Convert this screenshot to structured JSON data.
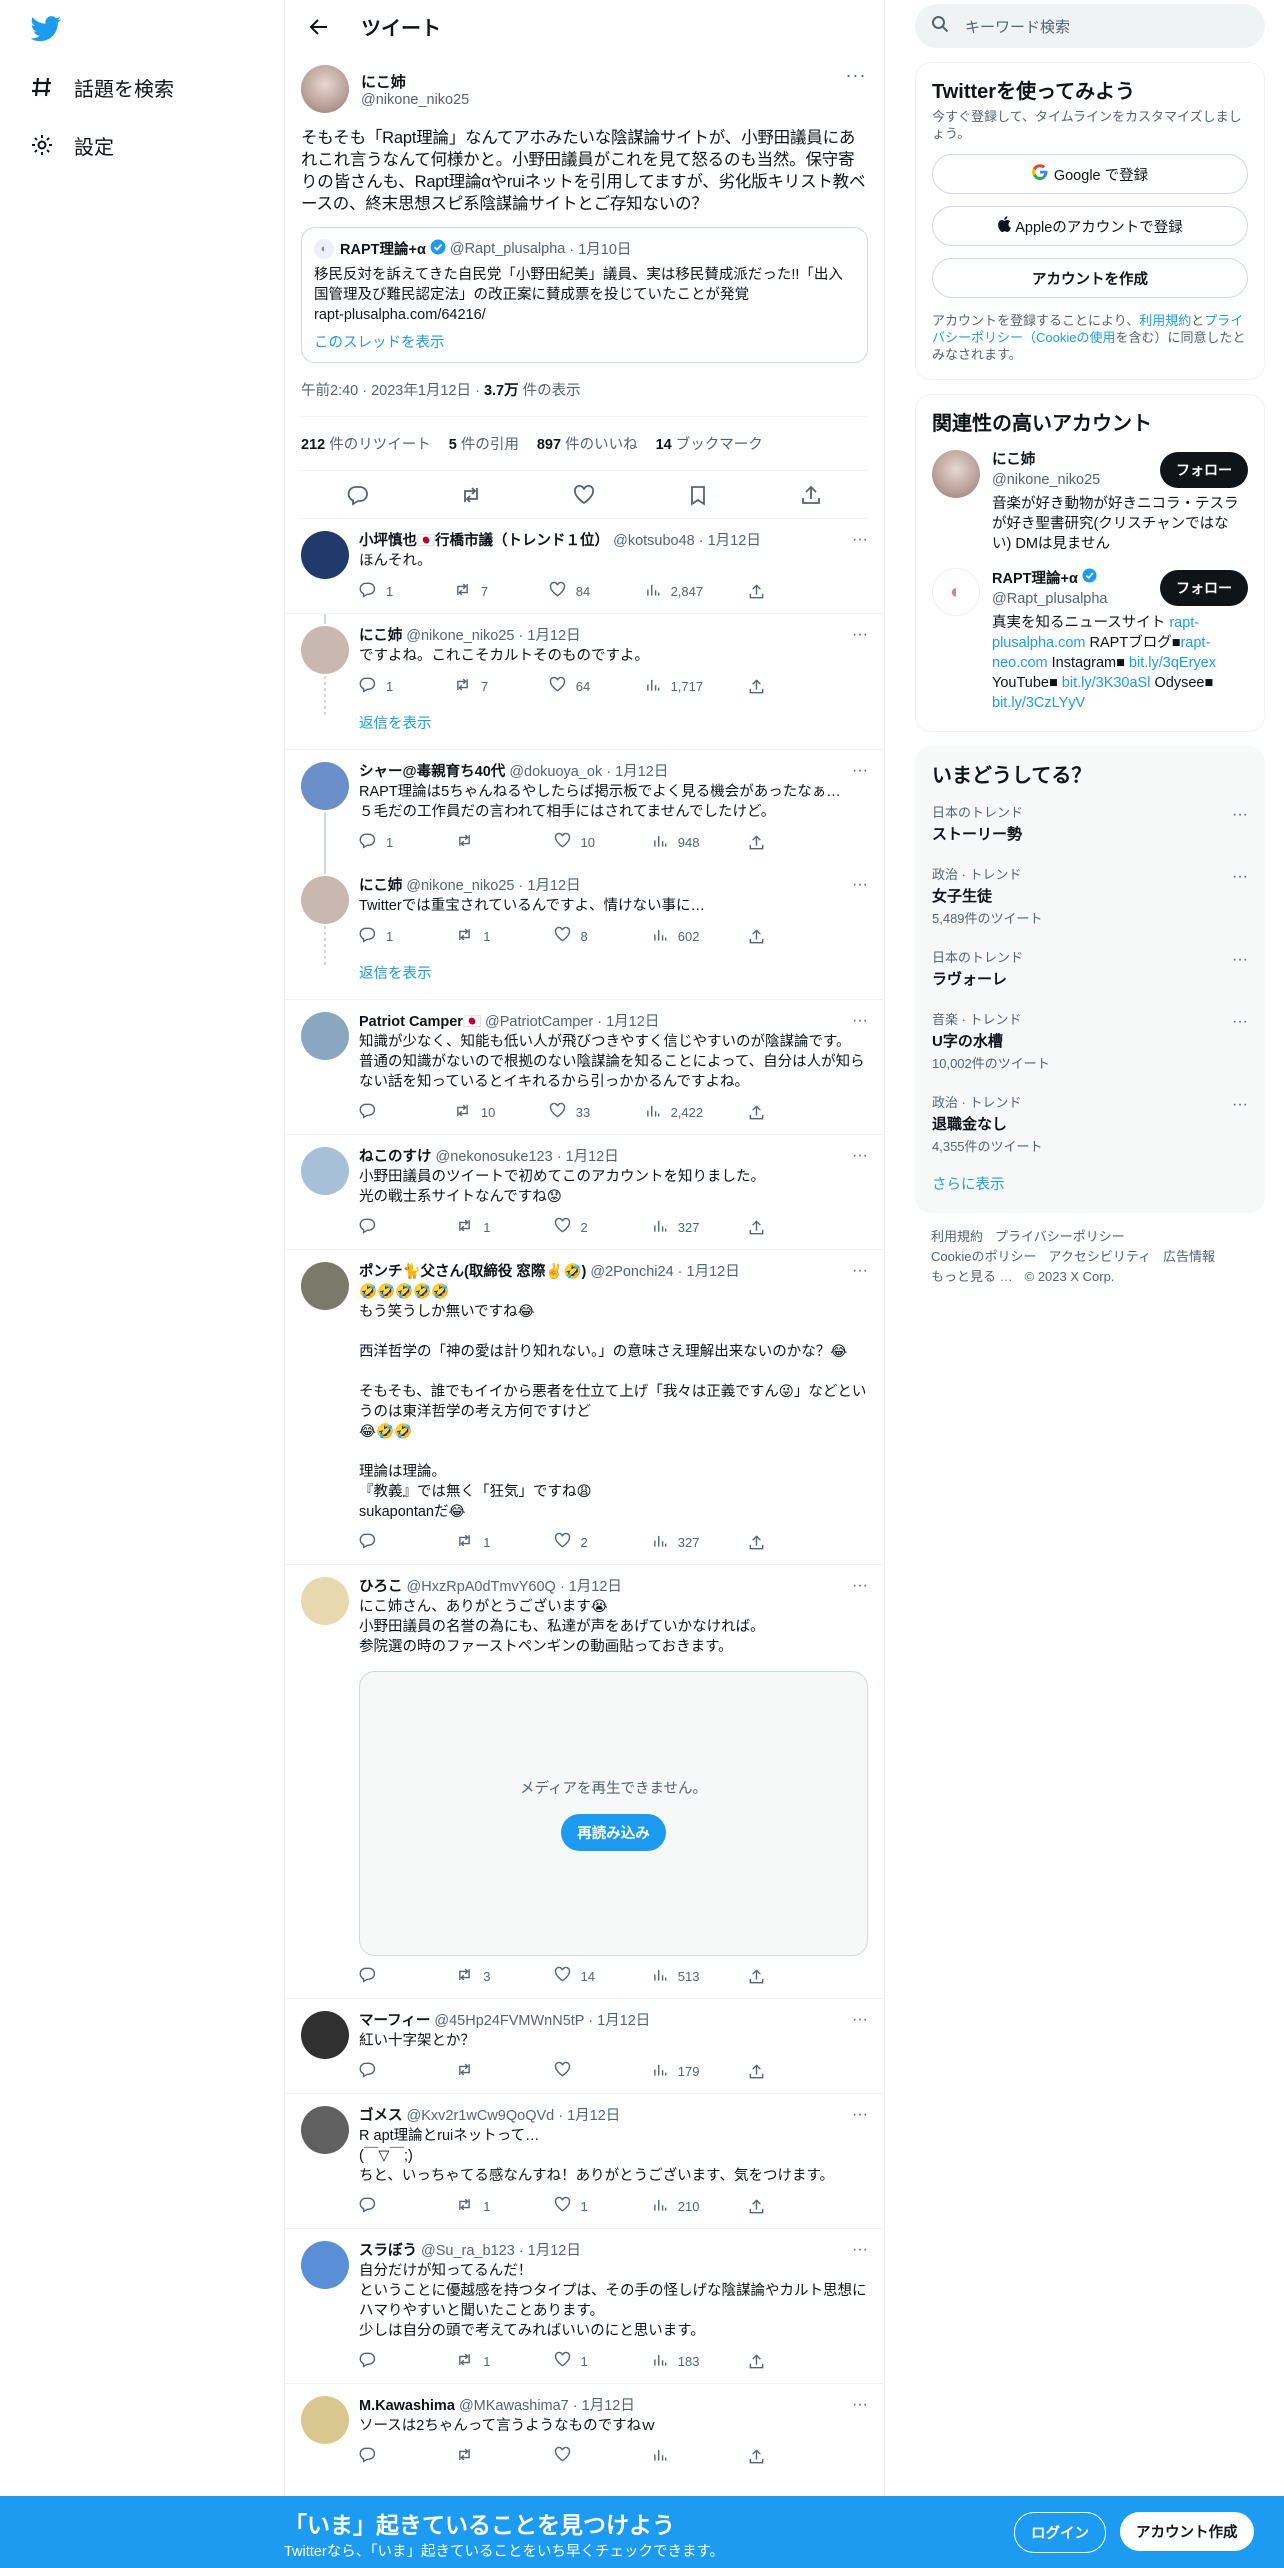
{
  "nav": {
    "explore": "話題を検索",
    "settings": "設定"
  },
  "header": {
    "title": "ツイート"
  },
  "focus": {
    "name": "にこ姉",
    "handle": "@nikone_niko25",
    "text": "そもそも「Rapt理論」なんてアホみたいな陰謀論サイトが、小野田議員にあれこれ言うなんて何様かと。小野田議員がこれを見て怒るのも当然。保守寄りの皆さんも、Rapt理論αやruiネットを引用してますが、劣化版キリスト教ベースの、終末思想スピ系陰謀論サイトとご存知ないの？",
    "quote": {
      "name": "RAPT理論+α",
      "handle": "@Rapt_plusalpha",
      "date": "· 1月10日",
      "text": "移民反対を訴えてきた自民党「小野田紀美」議員、実は移民賛成派だった!!「出入国管理及び難民認定法」の改正案に賛成票を投じていたことが発覚\nrapt-plusalpha.com/64216/",
      "thread_link": "このスレッドを表示"
    },
    "meta_time": "午前2:40 · 2023年1月12日 · ",
    "meta_views": "3.7万",
    "meta_views_label": " 件の表示",
    "stats": {
      "rt": "212",
      "rt_label": " 件のリツイート",
      "quotes": "5",
      "quotes_label": " 件の引用",
      "likes": "897",
      "likes_label": " 件のいいね",
      "bm": "14",
      "bm_label": " ブックマーク"
    }
  },
  "replies": [
    {
      "name": "小坪慎也🇯🇵行橋市議（トレンド１位）",
      "handle": "@kotsubo48",
      "date": "· 1月12日",
      "text": "ほんそれ。",
      "reply": "1",
      "rt": "7",
      "like": "84",
      "views": "2,847",
      "avatar": "#1f3a6b"
    },
    {
      "name": "にこ姉",
      "handle": "@nikone_niko25",
      "date": "· 1月12日",
      "text": "ですよね。これこそカルトそのものですよ。",
      "reply": "1",
      "rt": "7",
      "like": "64",
      "views": "1,717",
      "avatar": "#c8b8b0"
    },
    {
      "name": "シャー@毒親育ち40代",
      "handle": "@dokuoya_ok",
      "date": "· 1月12日",
      "text": "RAPT理論は5ちゃんねるやしたらば掲示板でよく見る機会があったなぁ…\n５毛だの工作員だの言われて相手にはされてませんでしたけど。",
      "reply": "1",
      "rt": "",
      "like": "10",
      "views": "948",
      "avatar": "#6b8fc8"
    },
    {
      "name": "にこ姉",
      "handle": "@nikone_niko25",
      "date": "· 1月12日",
      "text": "Twitterでは重宝されているんですよ、情けない事に…",
      "reply": "1",
      "rt": "1",
      "like": "8",
      "views": "602",
      "avatar": "#c8b8b0"
    },
    {
      "name": "Patriot Camper🇯🇵",
      "handle": "@PatriotCamper",
      "date": "· 1月12日",
      "text": "知識が少なく、知能も低い人が飛びつきやすく信じやすいのが陰謀論です。\n普通の知識がないので根拠のない陰謀論を知ることによって、自分は人が知らない話を知っているとイキれるから引っかかるんですよね。",
      "reply": "",
      "rt": "10",
      "like": "33",
      "views": "2,422",
      "avatar": "#8aa6c0"
    },
    {
      "name": "ねこのすけ",
      "handle": "@nekonosuke123",
      "date": "· 1月12日",
      "text": "小野田議員のツイートで初めてこのアカウントを知りました。\n光の戦士系サイトなんですね😟",
      "reply": "",
      "rt": "1",
      "like": "2",
      "views": "327",
      "avatar": "#a8bfd8"
    },
    {
      "name": "ポンチ🐈父さん(取締役 窓際✌️🤣)",
      "handle": "@2Ponchi24",
      "date": "· 1月12日",
      "text": "🤣🤣🤣🤣🤣\nもう笑うしか無いですね😂\n\n西洋哲学の「神の愛は計り知れない。」の意味さえ理解出来ないのかな？😂\n\nそもそも、誰でもイイから悪者を仕立て上げ「我々は正義ですん😜」などというのは東洋哲学の考え方何ですけど\n😂🤣🤣\n\n理論は理論。\n『教義』では無く「狂気」ですね😩\nsukapontanだ😂",
      "reply": "",
      "rt": "1",
      "like": "2",
      "views": "327",
      "avatar": "#7a7a6a"
    },
    {
      "name": "ひろこ",
      "handle": "@HxzRpA0dTmvY60Q",
      "date": "· 1月12日",
      "text": "にこ姉さん、ありがとうございます😭\n小野田議員の名誉の為にも、私達が声をあげていかなければ。\n参院選の時のファーストペンギンの動画貼っておきます。",
      "reply": "",
      "rt": "3",
      "like": "14",
      "views": "513",
      "avatar": "#e8d8b0"
    },
    {
      "name": "マーフィー",
      "handle": "@45Hp24FVMWnN5tP",
      "date": "· 1月12日",
      "text": "紅い十字架とか？",
      "reply": "",
      "rt": "",
      "like": "",
      "views": "179",
      "avatar": "#303030"
    },
    {
      "name": "ゴメス",
      "handle": "@Kxv2r1wCw9QoQVd",
      "date": "· 1月12日",
      "text": "R apt理論とruiネットって…\n(￣▽￣;)\nちと、いっちゃてる感なんすね！ありがとうございます、気をつけます。",
      "reply": "",
      "rt": "1",
      "like": "1",
      "views": "210",
      "avatar": "#606060"
    },
    {
      "name": "スラぼう",
      "handle": "@Su_ra_b123",
      "date": "· 1月12日",
      "text": "自分だけが知ってるんだ！\nということに優越感を持つタイプは、その手の怪しげな陰謀論やカルト思想にハマりやすいと聞いたことあります。\n少しは自分の頭で考えてみればいいのにと思います。",
      "reply": "",
      "rt": "1",
      "like": "1",
      "views": "183",
      "avatar": "#5a8fd8"
    },
    {
      "name": "M.Kawashima",
      "handle": "@MKawashima7",
      "date": "· 1月12日",
      "text": "ソースは2ちゃんって言うようなものですねｗ",
      "reply": "",
      "rt": "",
      "like": "",
      "views": "",
      "avatar": "#d8c890"
    }
  ],
  "show_replies": "返信を表示",
  "media": {
    "msg": "メディアを再生できません。",
    "btn": "再読み込み"
  },
  "right": {
    "search_placeholder": "キーワード検索",
    "signup_title": "Twitterを使ってみよう",
    "signup_sub": "今すぐ登録して、タイムラインをカスタマイズしましょう。",
    "google": "Google で登録",
    "apple": "Appleのアカウントで登録",
    "create": "アカウントを作成",
    "legal1": "アカウントを登録することにより、",
    "legal_terms": "利用規約",
    "legal2": "と",
    "legal_privacy": "プライバシーポリシー（Cookieの使用",
    "legal3": "を含む）に同意したとみなされます。",
    "rel_title": "関連性の高いアカウント",
    "rel": [
      {
        "name": "にこ姉",
        "handle": "@nikone_niko25",
        "bio": "音楽が好き動物が好きニコラ・テスラが好き聖書研究(クリスチャンではない) DMは見ません",
        "follow": "フォロー"
      },
      {
        "name": "RAPT理論+α",
        "handle": "@Rapt_plusalpha",
        "bio_a": "真実を知るニュースサイト ",
        "bio_link1": "rapt-plusalpha.com",
        "bio_b": " RAPTブログ■",
        "bio_link2": "rapt-neo.com",
        "bio_c": " Instagram■ ",
        "bio_link3": "bit.ly/3qEryex",
        "bio_d": " YouTube■ ",
        "bio_link4": "bit.ly/3K30aSl",
        "bio_e": " Odysee■ ",
        "bio_link5": "bit.ly/3CzLYyV",
        "follow": "フォロー"
      }
    ],
    "trends_title": "いまどうしてる？",
    "trends": [
      {
        "cat": "日本のトレンド",
        "name": "ストーリー勢",
        "count": ""
      },
      {
        "cat": "政治 · トレンド",
        "name": "女子生徒",
        "count": "5,489件のツイート"
      },
      {
        "cat": "日本のトレンド",
        "name": "ラヴォーレ",
        "count": ""
      },
      {
        "cat": "音楽 · トレンド",
        "name": "U字の水槽",
        "count": "10,002件のツイート"
      },
      {
        "cat": "政治 · トレンド",
        "name": "退職金なし",
        "count": "4,355件のツイート"
      }
    ],
    "more": "さらに表示",
    "footer": [
      "利用規約",
      "プライバシーポリシー",
      "Cookieのポリシー",
      "アクセシビリティ",
      "広告情報",
      "もっと見る …",
      "© 2023 X Corp."
    ]
  },
  "banner": {
    "t1": "「いま」起きていることを見つけよう",
    "t2": "Twitterなら、「いま」起きていることをいち早くチェックできます。",
    "login": "ログイン",
    "signup": "アカウント作成"
  }
}
